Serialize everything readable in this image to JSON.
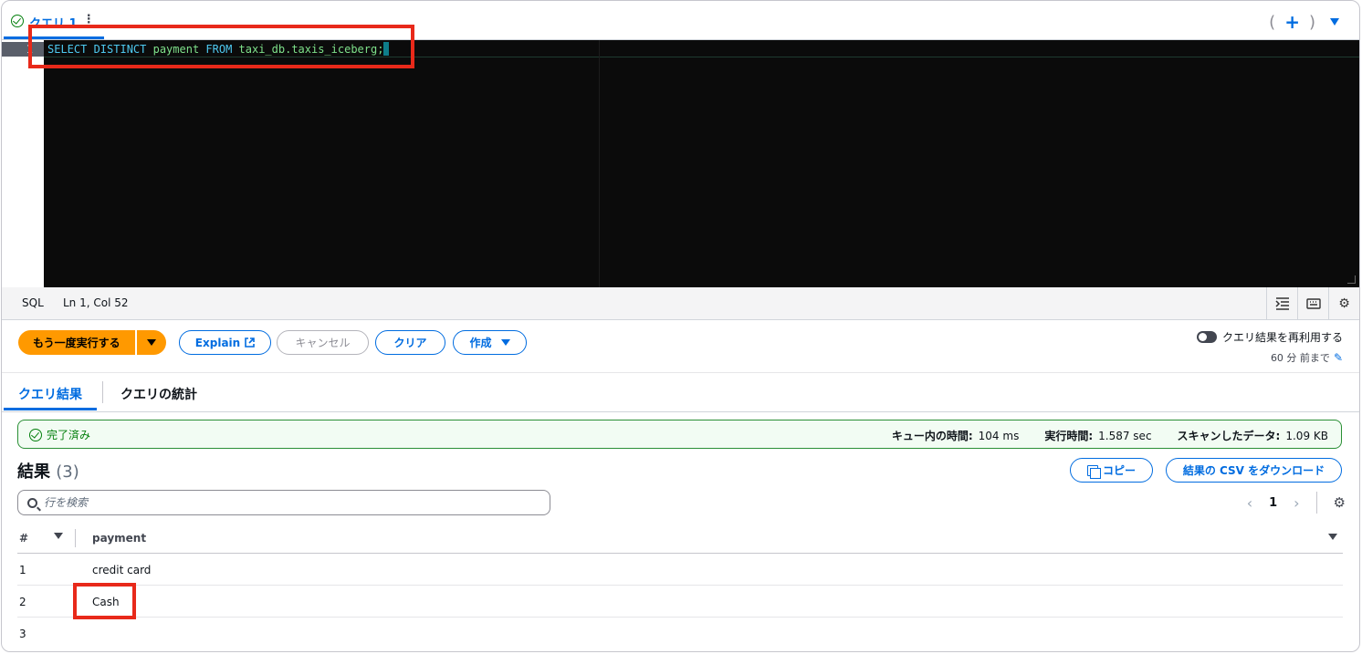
{
  "tab": {
    "label": "クエリ 1",
    "more": "⋮",
    "add": "+"
  },
  "editor": {
    "line_number": "1",
    "code_keywords": [
      "SELECT",
      "DISTINCT",
      "FROM"
    ],
    "kw1": "SELECT DISTINCT ",
    "id1": "payment ",
    "kw2": "FROM ",
    "id2": "taxi_db.taxis_iceberg;"
  },
  "statusbar": {
    "language": "SQL",
    "position": "Ln 1, Col 52"
  },
  "actions": {
    "run_label": "もう一度実行する",
    "explain_label": "Explain",
    "cancel_label": "キャンセル",
    "clear_label": "クリア",
    "create_label": "作成",
    "reuse_label": "クエリ結果を再利用する",
    "reuse_age": "60 分 前まで"
  },
  "result_tabs": {
    "results": "クエリ結果",
    "stats": "クエリの統計"
  },
  "banner": {
    "status": "完了済み",
    "queue_label": "キュー内の時間:",
    "queue_value": "104 ms",
    "exec_label": "実行時間:",
    "exec_value": "1.587 sec",
    "scan_label": "スキャンしたデータ:",
    "scan_value": "1.09 KB"
  },
  "results": {
    "title": "結果",
    "count": "(3)",
    "copy_label": "コピー",
    "csv_label": "結果の CSV をダウンロード",
    "search_placeholder": "行を検索",
    "page": "1"
  },
  "table": {
    "columns": [
      "#",
      "payment"
    ],
    "rows": [
      {
        "n": "1",
        "payment": "credit card"
      },
      {
        "n": "2",
        "payment": "Cash"
      },
      {
        "n": "3",
        "payment": ""
      }
    ]
  },
  "colors": {
    "accent": "#006ce0",
    "primary_button": "#ff9900",
    "success": "#037f0c",
    "highlight": "#e8291a"
  }
}
